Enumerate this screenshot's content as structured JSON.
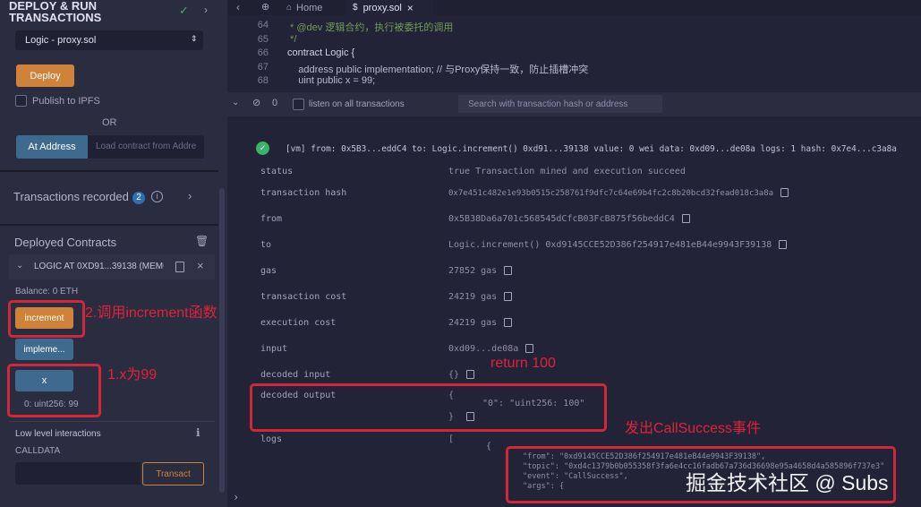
{
  "left": {
    "title_line1": "DEPLOY & RUN",
    "title_line2": "TRANSACTIONS",
    "contract_select": "Logic - proxy.sol",
    "deploy_label": "Deploy",
    "publish_label": "Publish to IPFS",
    "or_label": "OR",
    "at_address_label": "At Address",
    "at_address_placeholder": "Load contract from Addre",
    "transactions_recorded_label": "Transactions recorded",
    "transactions_recorded_count": "2",
    "deployed_contracts_label": "Deployed Contracts",
    "contract_instance": "LOGIC AT 0XD91...39138 (MEMC",
    "balance": "Balance: 0 ETH",
    "increment_label": "increment",
    "impl_label": "impleme...",
    "x_label": "x",
    "x_value": "0: uint256: 99",
    "low_level_label": "Low level interactions",
    "calldata_label": "CALLDATA",
    "transact_label": "Transact",
    "annot_increment": "2.调用increment函数",
    "annot_x": "1.x为99"
  },
  "tabs": {
    "home": "Home",
    "file": "proxy.sol"
  },
  "editor": {
    "lines": [
      {
        "num": "64",
        "text": " * @dev 逻辑合约，执行被委托的调用"
      },
      {
        "num": "65",
        "text": " */"
      },
      {
        "num": "66",
        "text": "contract Logic {"
      },
      {
        "num": "67",
        "text": "    address public implementation; // 与Proxy保持一致，防止插槽冲突"
      },
      {
        "num": "68",
        "text": "    uint public x = 99;"
      }
    ]
  },
  "terminal_bar": {
    "count": "0",
    "listen_label": "listen on all transactions",
    "search_placeholder": "Search with transaction hash or address"
  },
  "tx": {
    "summary": "[vm] from: 0x5B3...eddC4 to: Logic.increment() 0xd91...39138 value: 0 wei data: 0xd09...de08a logs: 1 hash: 0x7e4...c3a8a",
    "rows": [
      {
        "key": "status",
        "value": "true Transaction mined and execution succeed"
      },
      {
        "key": "transaction hash",
        "value": "0x7e451c482e1e93b0515c258761f9dfc7c64e69b4fc2c8b20bcd32fead018c3a8a"
      },
      {
        "key": "from",
        "value": "0x5B38Da6a701c568545dCfcB03FcB875f56beddC4"
      },
      {
        "key": "to",
        "value": "Logic.increment() 0xd9145CCE52D386f254917e481eB44e9943F39138"
      },
      {
        "key": "gas",
        "value": "27852 gas"
      },
      {
        "key": "transaction cost",
        "value": "24219 gas"
      },
      {
        "key": "execution cost",
        "value": "24219 gas"
      },
      {
        "key": "input",
        "value": "0xd09...de08a"
      },
      {
        "key": "decoded input",
        "value": "{}"
      },
      {
        "key": "decoded output",
        "value": "{"
      },
      {
        "key": "logs",
        "value": "["
      }
    ],
    "decoded_output_inner": "\"0\": \"uint256: 100\"",
    "decoded_output_close": "}",
    "logs_open": "{",
    "log_lines": [
      "\"from\": \"0xd9145CCE52D386f254917e481eB44e9943F39138\",",
      "\"topic\": \"0xd4c1379b0b055358f3fa6e4cc16fadb67a736d36698e95a4658d4a585896f737e3\",",
      "\"event\": \"CallSuccess\",",
      "\"args\": {"
    ],
    "annot_return": "return 100",
    "annot_event": "发出CallSuccess事件"
  },
  "watermark": "掘金技术社区 @ Subs"
}
